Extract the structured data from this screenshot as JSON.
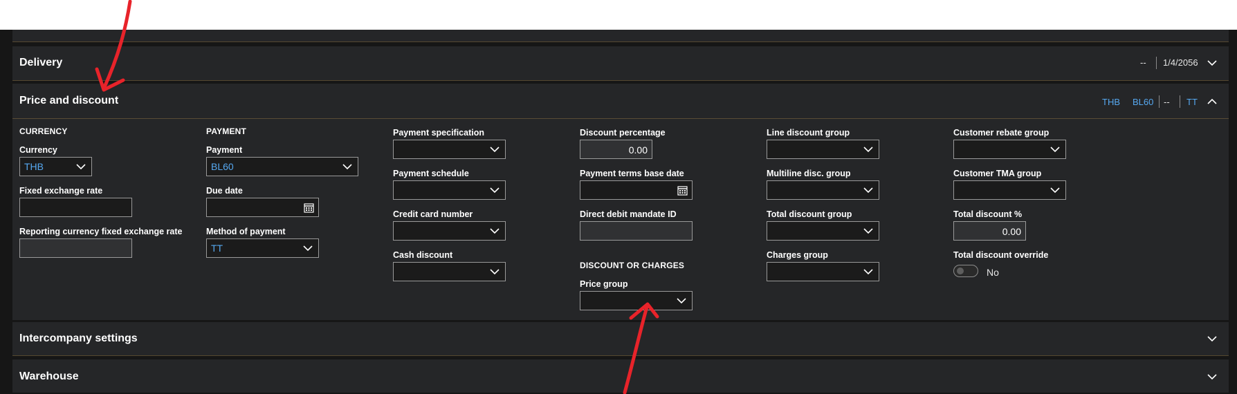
{
  "sections": {
    "delivery": {
      "title": "Delivery",
      "summary_dash": "--",
      "summary_date": "1/4/2056"
    },
    "price": {
      "title": "Price and discount",
      "summary_currency": "THB",
      "summary_payment": "BL60",
      "summary_dash": "--",
      "summary_method": "TT"
    },
    "intercompany": {
      "title": "Intercompany settings"
    },
    "warehouse": {
      "title": "Warehouse"
    }
  },
  "currency_group": {
    "heading": "CURRENCY",
    "currency_label": "Currency",
    "currency_value": "THB",
    "fixed_rate_label": "Fixed exchange rate",
    "fixed_rate_value": "",
    "reporting_rate_label": "Reporting currency fixed exchange rate",
    "reporting_rate_value": ""
  },
  "payment_group": {
    "heading": "PAYMENT",
    "payment_label": "Payment",
    "payment_value": "BL60",
    "due_date_label": "Due date",
    "due_date_value": "",
    "method_label": "Method of payment",
    "method_value": "TT"
  },
  "col3": {
    "payment_spec_label": "Payment specification",
    "payment_spec_value": "",
    "payment_schedule_label": "Payment schedule",
    "payment_schedule_value": "",
    "credit_card_label": "Credit card number",
    "credit_card_value": "",
    "cash_discount_label": "Cash discount",
    "cash_discount_value": ""
  },
  "col4": {
    "discount_pct_label": "Discount percentage",
    "discount_pct_value": "0.00",
    "terms_base_date_label": "Payment terms base date",
    "terms_base_date_value": "",
    "debit_mandate_label": "Direct debit mandate ID",
    "debit_mandate_value": "",
    "discount_charges_heading": "DISCOUNT OR CHARGES",
    "price_group_label": "Price group",
    "price_group_value": ""
  },
  "col5": {
    "line_disc_label": "Line discount group",
    "line_disc_value": "",
    "multiline_label": "Multiline disc. group",
    "multiline_value": "",
    "total_disc_group_label": "Total discount group",
    "total_disc_group_value": "",
    "charges_label": "Charges group",
    "charges_value": ""
  },
  "col6": {
    "rebate_label": "Customer rebate group",
    "rebate_value": "",
    "tma_label": "Customer TMA group",
    "tma_value": "",
    "total_disc_pct_label": "Total discount %",
    "total_disc_pct_value": "0.00",
    "override_label": "Total discount override",
    "override_value": "No"
  },
  "colors": {
    "link": "#56a8f0",
    "annotation": "#e8232a",
    "background": "#252628"
  },
  "icons": [
    "chevron-down-icon",
    "chevron-up-icon",
    "calendar-icon"
  ]
}
